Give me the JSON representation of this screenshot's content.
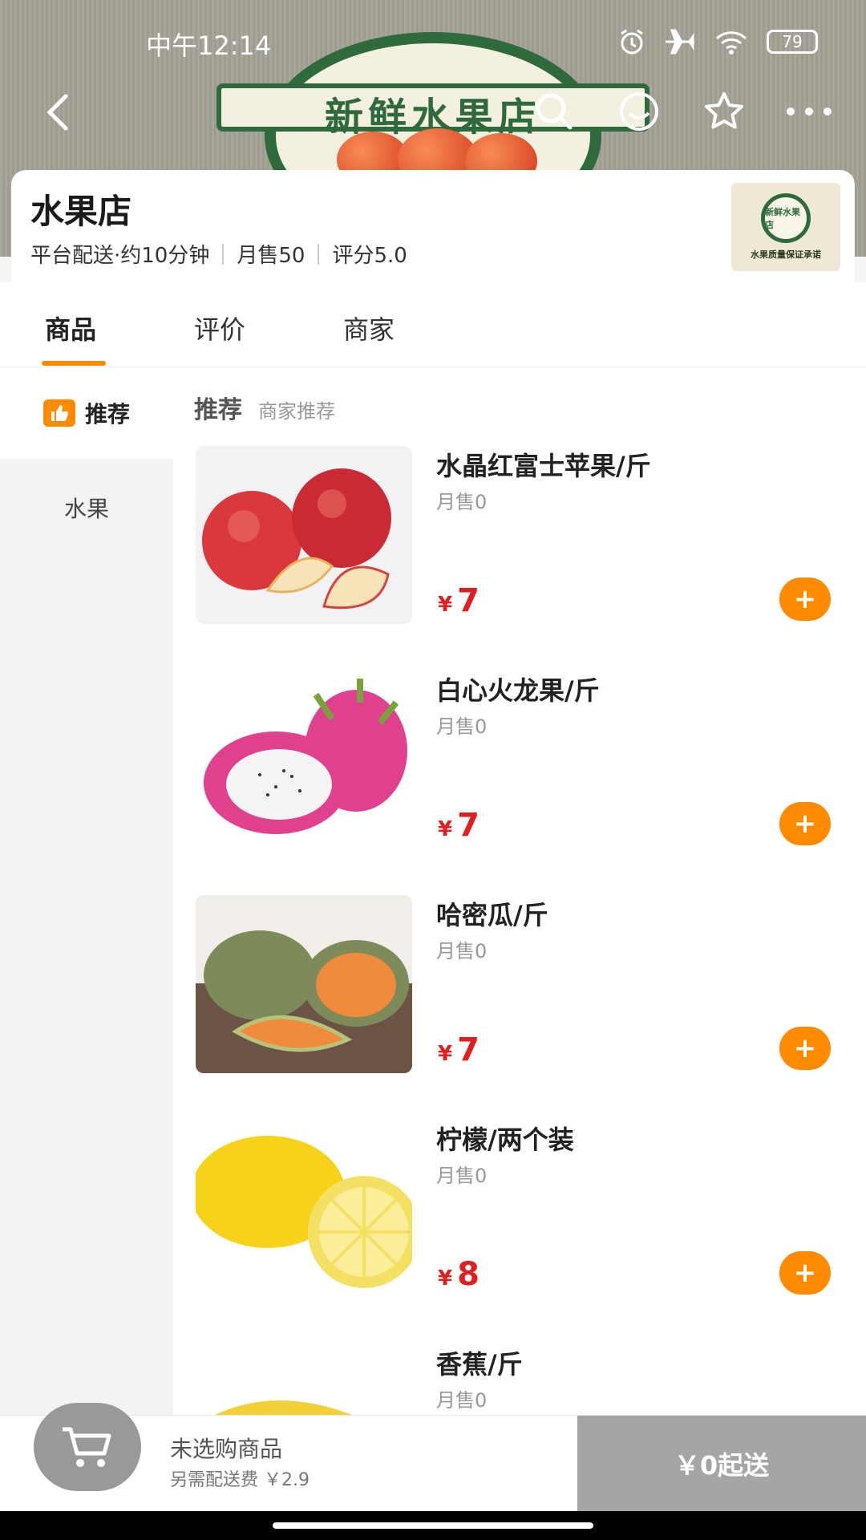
{
  "status": {
    "time": "中午12:14",
    "battery": "79"
  },
  "banner": {
    "logo_text": "新鲜水果店"
  },
  "shop": {
    "name": "水果店",
    "delivery": "平台配送·约10分钟",
    "monthly_sales": "月售50",
    "rating": "评分5.0",
    "logo_title": "新鲜水果店",
    "logo_caption": "水果质量保证承诺"
  },
  "tabs": [
    {
      "label": "商品",
      "active": true
    },
    {
      "label": "评价",
      "active": false
    },
    {
      "label": "商家",
      "active": false
    }
  ],
  "categories": [
    {
      "label": "推荐",
      "active": true,
      "icon": "thumbs-up-icon"
    },
    {
      "label": "水果",
      "active": false
    }
  ],
  "section": {
    "title": "推荐",
    "subtitle": "商家推荐"
  },
  "products": [
    {
      "name": "水晶红富士苹果/斤",
      "sold": "月售0",
      "currency": "¥",
      "price": "7"
    },
    {
      "name": "白心火龙果/斤",
      "sold": "月售0",
      "currency": "¥",
      "price": "7"
    },
    {
      "name": "哈密瓜/斤",
      "sold": "月售0",
      "currency": "¥",
      "price": "7"
    },
    {
      "name": "柠檬/两个装",
      "sold": "月售0",
      "currency": "¥",
      "price": "8"
    },
    {
      "name": "香蕉/斤",
      "sold": "月售0"
    }
  ],
  "cart": {
    "empty_text": "未选购商品",
    "delivery_fee": "另需配送费 ￥2.9",
    "checkout": "￥0起送"
  },
  "colors": {
    "accent": "#ff8a00",
    "price": "#e02020",
    "brand_green": "#2f6a3c"
  }
}
